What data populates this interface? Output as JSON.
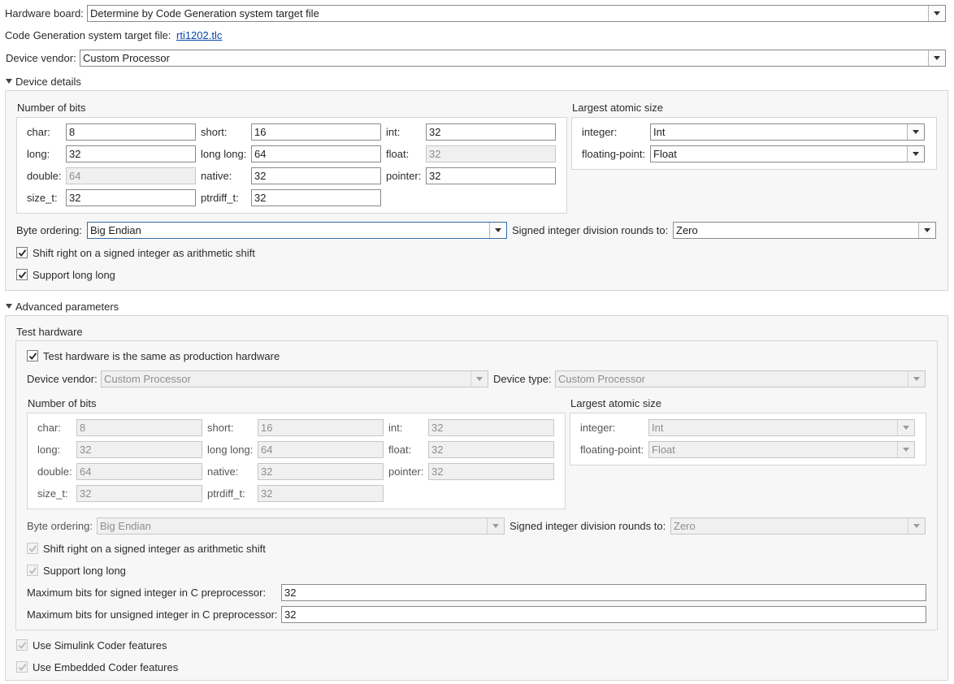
{
  "top": {
    "hardware_board_label": "Hardware board:",
    "hardware_board_value": "Determine by Code Generation system target file",
    "target_file_label": "Code Generation system target file:",
    "target_file_link": "rti1202.tlc",
    "device_vendor_label": "Device vendor:",
    "device_vendor_value": "Custom Processor"
  },
  "device_details": {
    "section_title": "Device details",
    "number_of_bits_title": "Number of bits",
    "bits": {
      "char_label": "char:",
      "char": "8",
      "short_label": "short:",
      "short": "16",
      "int_label": "int:",
      "int": "32",
      "long_label": "long:",
      "long": "32",
      "long_long_label": "long long:",
      "long_long": "64",
      "float_label": "float:",
      "float": "32",
      "double_label": "double:",
      "double": "64",
      "native_label": "native:",
      "native": "32",
      "pointer_label": "pointer:",
      "pointer": "32",
      "size_t_label": "size_t:",
      "size_t": "32",
      "ptrdiff_t_label": "ptrdiff_t:",
      "ptrdiff_t": "32"
    },
    "largest_atomic_title": "Largest atomic size",
    "integer_label": "integer:",
    "integer_value": "Int",
    "floating_point_label": "floating-point:",
    "floating_point_value": "Float",
    "byte_ordering_label": "Byte ordering:",
    "byte_ordering_value": "Big Endian",
    "signed_div_label": "Signed integer division rounds to:",
    "signed_div_value": "Zero",
    "shift_right_label": "Shift right on a signed integer as arithmetic shift",
    "shift_right_checked": true,
    "support_long_long_label": "Support long long",
    "support_long_long_checked": true
  },
  "advanced": {
    "section_title": "Advanced parameters",
    "test_hardware_title": "Test hardware",
    "same_as_production_label": "Test hardware is the same as production hardware",
    "same_as_production_checked": true,
    "device_vendor_label": "Device vendor:",
    "device_vendor_value": "Custom Processor",
    "device_type_label": "Device type:",
    "device_type_value": "Custom Processor",
    "number_of_bits_title": "Number of bits",
    "bits": {
      "char_label": "char:",
      "char": "8",
      "short_label": "short:",
      "short": "16",
      "int_label": "int:",
      "int": "32",
      "long_label": "long:",
      "long": "32",
      "long_long_label": "long long:",
      "long_long": "64",
      "float_label": "float:",
      "float": "32",
      "double_label": "double:",
      "double": "64",
      "native_label": "native:",
      "native": "32",
      "pointer_label": "pointer:",
      "pointer": "32",
      "size_t_label": "size_t:",
      "size_t": "32",
      "ptrdiff_t_label": "ptrdiff_t:",
      "ptrdiff_t": "32"
    },
    "largest_atomic_title": "Largest atomic size",
    "integer_label": "integer:",
    "integer_value": "Int",
    "floating_point_label": "floating-point:",
    "floating_point_value": "Float",
    "byte_ordering_label": "Byte ordering:",
    "byte_ordering_value": "Big Endian",
    "signed_div_label": "Signed integer division rounds to:",
    "signed_div_value": "Zero",
    "shift_right_label": "Shift right on a signed integer as arithmetic shift",
    "support_long_long_label": "Support long long",
    "max_signed_label": "Maximum bits for signed integer in C preprocessor:",
    "max_signed_value": "32",
    "max_unsigned_label": "Maximum bits for unsigned integer in C preprocessor:",
    "max_unsigned_value": "32",
    "use_simulink_coder_label": "Use Simulink Coder features",
    "use_embedded_coder_label": "Use Embedded Coder features"
  },
  "colors": {
    "link": "#0645ad",
    "focus_border": "#2e6ea6",
    "panel_bg": "#f7f7f7",
    "disabled_bg": "#f0f0f0"
  }
}
